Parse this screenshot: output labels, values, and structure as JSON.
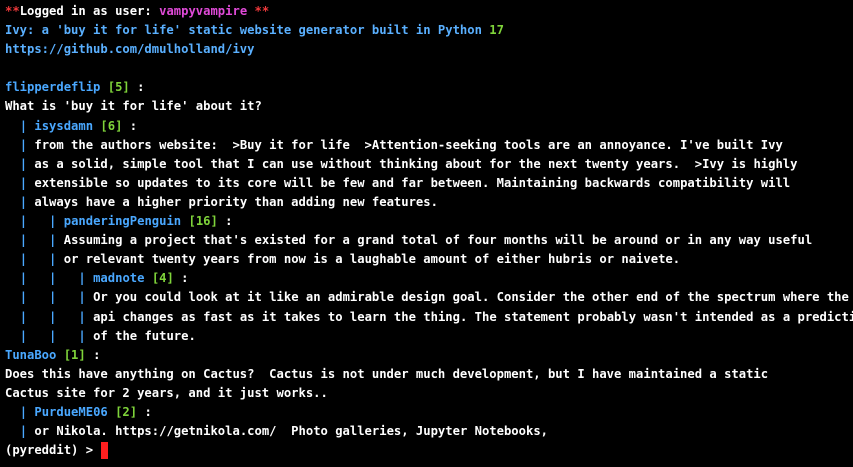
{
  "login": {
    "prefix": "**",
    "text": "Logged in as user: ",
    "user": "vampyvampire",
    "suffix": " **"
  },
  "post": {
    "title": "Ivy: a 'buy it for life' static website generator built in Python",
    "score": "17",
    "url": "https://github.com/dmulholland/ivy"
  },
  "comments": [
    {
      "author": "flipperdeflip",
      "score": "[5]",
      "lines": [
        "What is 'buy it for life' about it?"
      ]
    },
    {
      "author": "isysdamn",
      "score": "[6]",
      "lines": [
        "from the authors website:  >Buy it for life  >Attention-seeking tools are an annoyance. I've built Ivy",
        "as a solid, simple tool that I can use without thinking about for the next twenty years.  >Ivy is highly",
        "extensible so updates to its core will be few and far between. Maintaining backwards compatibility will",
        "always have a higher priority than adding new features."
      ]
    },
    {
      "author": "panderingPenguin",
      "score": "[16]",
      "lines": [
        "Assuming a project that's existed for a grand total of four months will be around or in any way useful",
        "or relevant twenty years from now is a laughable amount of either hubris or naivete."
      ]
    },
    {
      "author": "madnote",
      "score": "[4]",
      "lines": [
        "Or you could look at it like an admirable design goal. Consider the other end of the spectrum where the",
        "api changes as fast as it takes to learn the thing. The statement probably wasn't intended as a prediction",
        "of the future."
      ]
    },
    {
      "author": "TunaBoo",
      "score": "[1]",
      "lines": [
        "Does this have anything on Cactus?  Cactus is not under much development, but I have maintained a static",
        "Cactus site for 2 years, and it just works.."
      ]
    },
    {
      "author": "PurdueME06",
      "score": "[2]",
      "lines": [
        "or Nikola. https://getnikola.com/  Photo galleries, Jupyter Notebooks,"
      ]
    }
  ],
  "prompt": "(pyreddit) > ",
  "colors": {
    "background": "#000000",
    "text": "#ffffff",
    "author": "#4aa8ff",
    "score": "#7fd43a",
    "username": "#e04ad8",
    "marker": "#f0393b",
    "cursor": "#ff1f1f"
  }
}
